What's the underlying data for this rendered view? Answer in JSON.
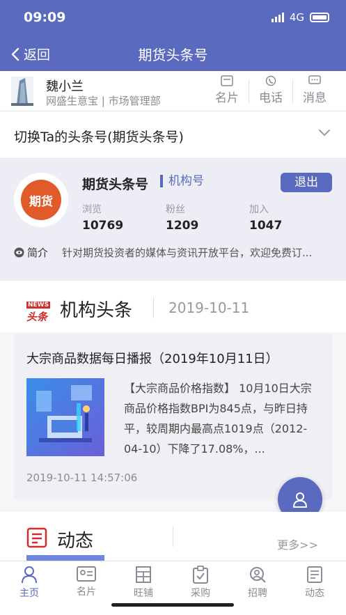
{
  "status_bar": {
    "time": "09:09",
    "network": "4G"
  },
  "nav": {
    "back_label": "返回",
    "title": "期货头条号"
  },
  "profile": {
    "name": "魏小兰",
    "org": "网盛生意宝 | 市场管理部",
    "actions": [
      {
        "label": "名片",
        "icon": "card-icon"
      },
      {
        "label": "电话",
        "icon": "phone-icon"
      },
      {
        "label": "消息",
        "icon": "message-icon"
      }
    ]
  },
  "switcher": {
    "label": "切换Ta的头条号(期货头条号)"
  },
  "account": {
    "logo_text": "期货",
    "name": "期货头条号",
    "tag": "机构号",
    "quit_label": "退出",
    "stats": [
      {
        "label": "浏览",
        "value": "10769"
      },
      {
        "label": "粉丝",
        "value": "1209"
      },
      {
        "label": "加入",
        "value": "1047"
      }
    ],
    "intro_label": "简介",
    "intro_text": "针对期货投资者的媒体与资讯开放平台，欢迎免费订..."
  },
  "headlines": {
    "badge_top": "NEWS",
    "badge_bottom": "头条",
    "title": "机构头条",
    "date": "2019-10-11",
    "article": {
      "title": "大宗商品数据每日播报（2019年10月11日）",
      "summary": "【大宗商品价格指数】 10月10日大宗商品价格指数BPI为845点，与昨日持平，较周期内最高点1019点（2012-04-10）下降了17.08%，...",
      "time": "2019-10-11 14:57:06"
    }
  },
  "dynamic": {
    "title": "动态",
    "more_label": "更多>>"
  },
  "tabbar": {
    "items": [
      {
        "label": "主页",
        "icon": "home-icon",
        "active": true
      },
      {
        "label": "名片",
        "icon": "card-icon",
        "active": false
      },
      {
        "label": "旺铺",
        "icon": "shop-icon",
        "active": false
      },
      {
        "label": "采购",
        "icon": "purchase-icon",
        "active": false
      },
      {
        "label": "招聘",
        "icon": "recruit-icon",
        "active": false
      },
      {
        "label": "动态",
        "icon": "dynamic-icon",
        "active": false
      }
    ]
  },
  "colors": {
    "brand": "#5a6abf",
    "logo": "#e15a2a",
    "news_red": "#d12b2b"
  }
}
